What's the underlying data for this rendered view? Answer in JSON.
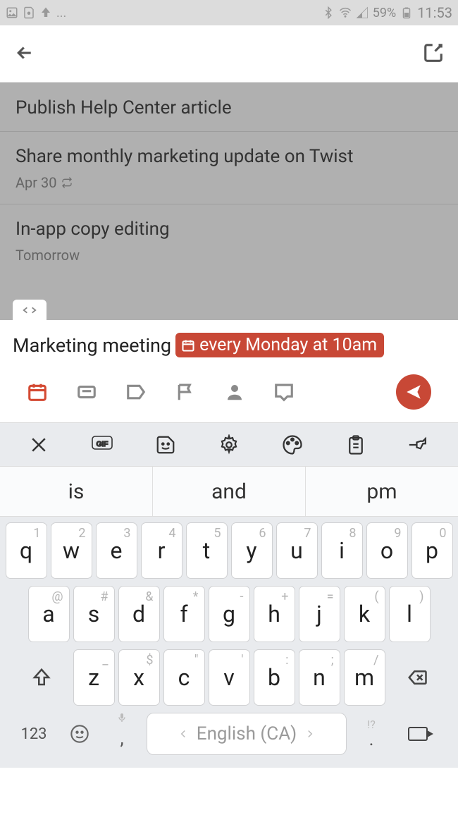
{
  "status": {
    "battery": "59%",
    "time": "11:53"
  },
  "tasks": [
    {
      "title": "Publish Help Center article",
      "meta": ""
    },
    {
      "title": "Share monthly marketing update on Twist",
      "meta": "Apr 30"
    },
    {
      "title": "In-app copy editing",
      "meta": "Tomorrow"
    }
  ],
  "quickAdd": {
    "text": "Marketing meeting",
    "chipLabel": "every Monday at 10am"
  },
  "keyboard": {
    "suggestions": [
      "is",
      "and",
      "pm"
    ],
    "row1": [
      {
        "l": "q",
        "h": "1"
      },
      {
        "l": "w",
        "h": "2"
      },
      {
        "l": "e",
        "h": "3"
      },
      {
        "l": "r",
        "h": "4"
      },
      {
        "l": "t",
        "h": "5"
      },
      {
        "l": "y",
        "h": "6"
      },
      {
        "l": "u",
        "h": "7"
      },
      {
        "l": "i",
        "h": "8"
      },
      {
        "l": "o",
        "h": "9"
      },
      {
        "l": "p",
        "h": "0"
      }
    ],
    "row2": [
      {
        "l": "a",
        "h": "@"
      },
      {
        "l": "s",
        "h": "#"
      },
      {
        "l": "d",
        "h": "&"
      },
      {
        "l": "f",
        "h": "*"
      },
      {
        "l": "g",
        "h": "-"
      },
      {
        "l": "h",
        "h": "+"
      },
      {
        "l": "j",
        "h": "="
      },
      {
        "l": "k",
        "h": "("
      },
      {
        "l": "l",
        "h": ")"
      }
    ],
    "row3": [
      {
        "l": "z",
        "h": "_"
      },
      {
        "l": "x",
        "h": "$"
      },
      {
        "l": "c",
        "h": "\""
      },
      {
        "l": "v",
        "h": "'"
      },
      {
        "l": "b",
        "h": ":"
      },
      {
        "l": "n",
        "h": ";"
      },
      {
        "l": "m",
        "h": "/"
      }
    ],
    "numLabel": "123",
    "spaceLabel": "English (CA)",
    "punct1": "!?",
    "punct2": ","
  }
}
